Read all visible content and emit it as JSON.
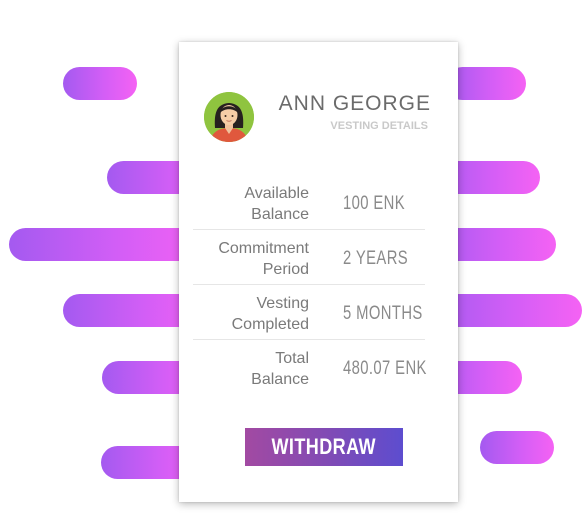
{
  "user": {
    "name": "ANN GEORGE",
    "subtitle": "VESTING DETAILS"
  },
  "details": [
    {
      "label_line1": "Available",
      "label_line2": "Balance",
      "value": "100 ENK"
    },
    {
      "label_line1": "Commitment",
      "label_line2": "Period",
      "value": "2 YEARS"
    },
    {
      "label_line1": "Vesting",
      "label_line2": "Completed",
      "value": "5 MONTHS"
    },
    {
      "label_line1": "Total",
      "label_line2": "Balance",
      "value": "480.07 ENK"
    }
  ],
  "actions": {
    "withdraw_label": "WITHDRAW"
  },
  "colors": {
    "accent_gradient_start": "#a24aa2",
    "accent_gradient_end": "#5d4dcf",
    "background_pill_start": "#a45af0",
    "background_pill_end": "#f562f4",
    "avatar_background": "#8fc43f"
  },
  "icons": {
    "avatar": "female-user-avatar-icon"
  }
}
